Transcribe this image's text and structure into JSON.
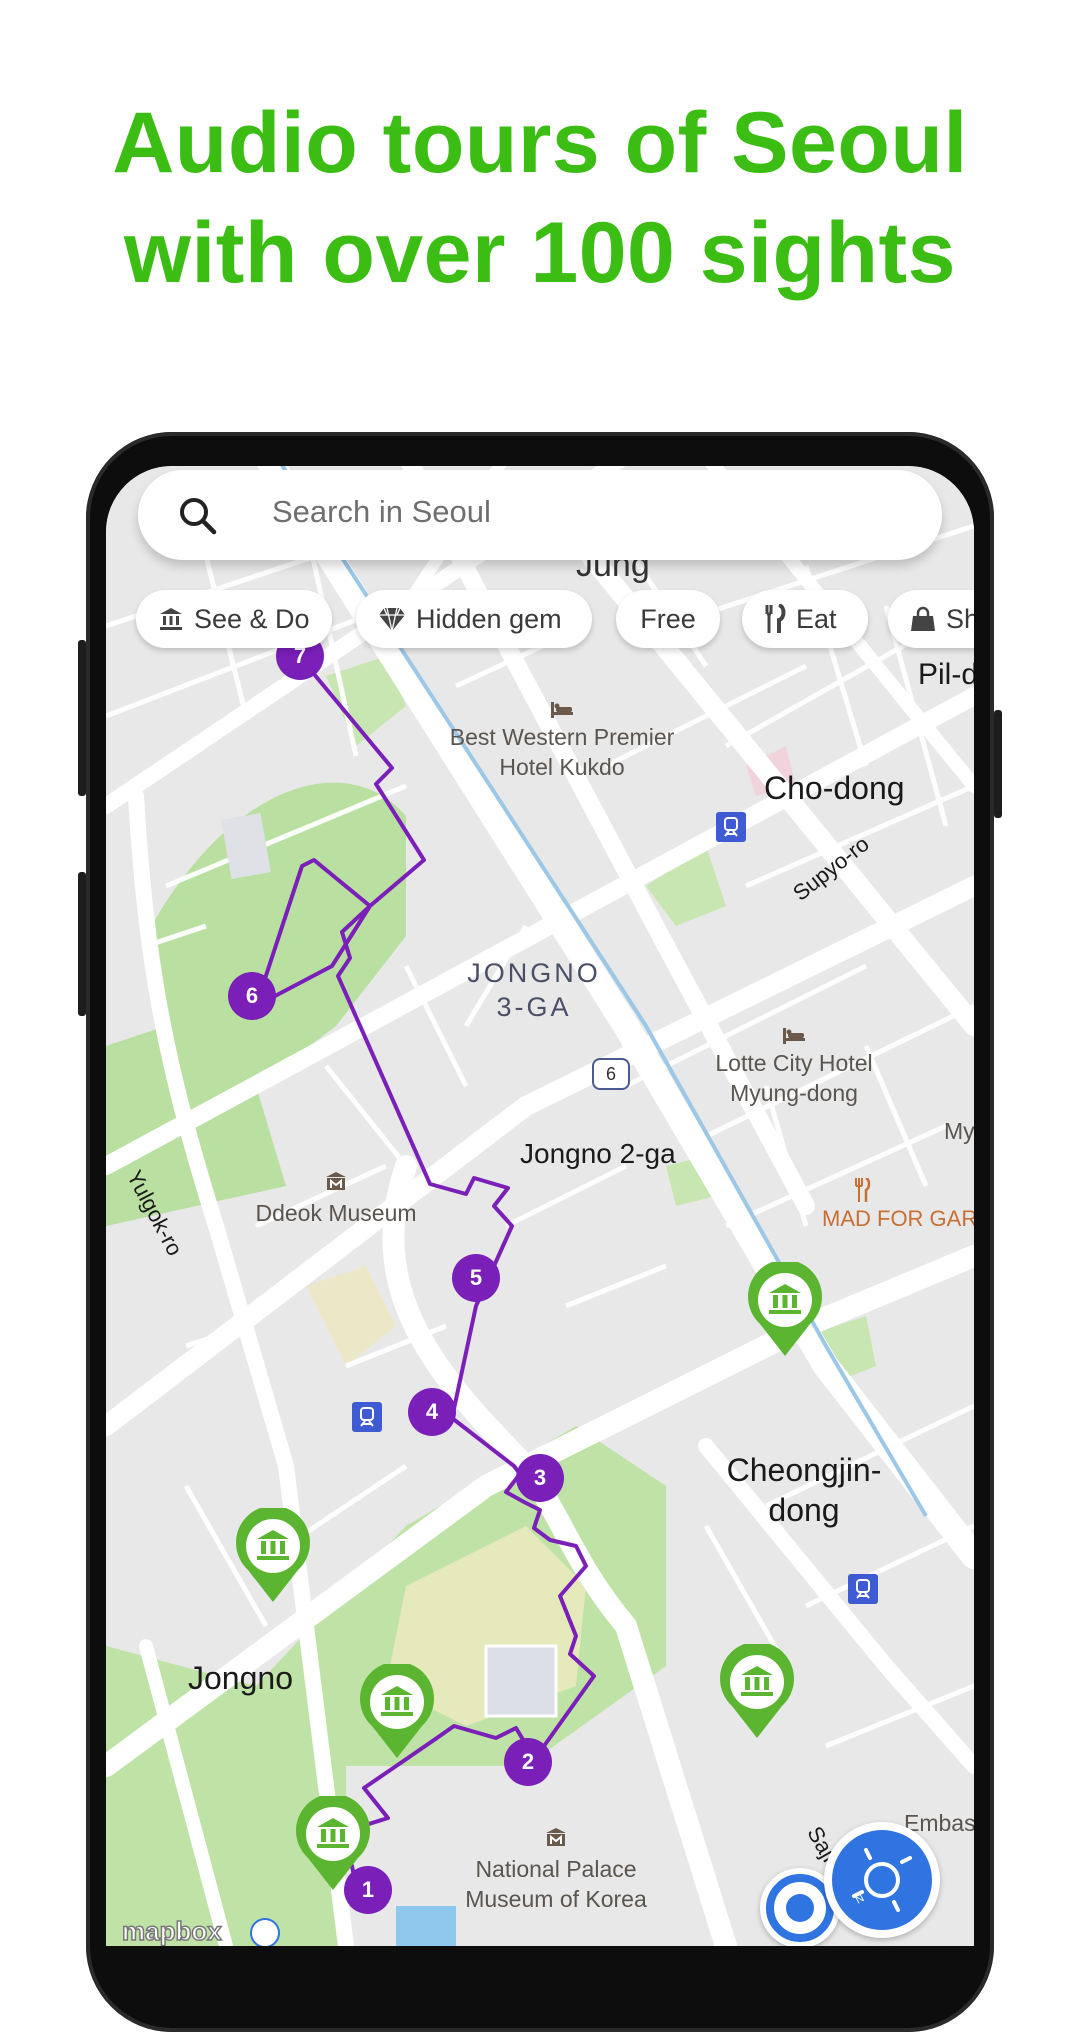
{
  "headline": {
    "line1": "Audio tours of Seoul",
    "line2": "with over 100 sights",
    "color": "#3bbd14"
  },
  "search": {
    "placeholder": "Search in Seoul",
    "icon": "search-icon"
  },
  "chips": [
    {
      "label": "See & Do",
      "icon": "museum-icon"
    },
    {
      "label": "Hidden gem",
      "icon": "diamond-icon"
    },
    {
      "label": "Free",
      "icon": ""
    },
    {
      "label": "Eat",
      "icon": "fork-knife-icon"
    },
    {
      "label": "Sh",
      "icon": "shopping-bag-icon"
    }
  ],
  "map": {
    "labels": {
      "top_partial": "Jung",
      "pil_dong": "Pil-d",
      "best_western_1": "Best Western Premier",
      "best_western_2": "Hotel Kukdo",
      "cho_dong": "Cho-dong",
      "supyo_ro": "Supyo-ro",
      "jongno3_1": "JONGNO",
      "jongno3_2": "3-GA",
      "route6": "6",
      "lotte_1": "Lotte City Hotel",
      "lotte_2": "Myung-dong",
      "my_partial": "My",
      "jongno2": "Jongno 2-ga",
      "mad_for_garlic": "MAD FOR GAR",
      "ddeok": "Ddeok Museum",
      "yulgok": "Yulgok-ro",
      "cheongjin_1": "Cheongjin-",
      "cheongjin_2": "dong",
      "jongno": "Jongno",
      "embassy": "Embas",
      "sajik": "Sajik",
      "npm_1": "National Palace",
      "npm_2": "Museum of Korea",
      "attribution": "mapbox"
    },
    "route_color": "#7a1fb8",
    "pin_color": "#5cb531",
    "tour_stops": [
      "1",
      "2",
      "3",
      "4",
      "5",
      "6",
      "7"
    ]
  },
  "controls": {
    "locate": "my-location-button",
    "compass": "compass-button"
  }
}
